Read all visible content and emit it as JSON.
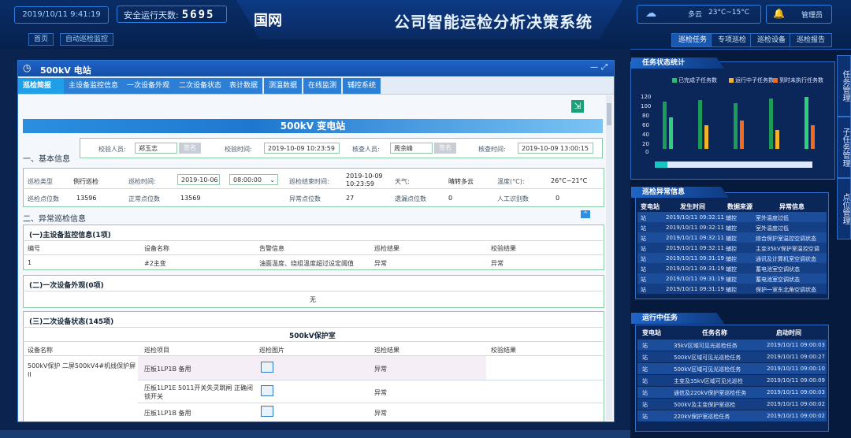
{
  "header": {
    "datetime": "2019/10/11 9:41:19",
    "safe_days_label": "安全运行天数:",
    "safe_days_value": "5695",
    "logo": "国网",
    "system_name": "公司智能运检分析决策系统",
    "weather_text": "多云",
    "temperature": "23°C~15°C",
    "user_label": "管理员",
    "breadcrumb": [
      "首页",
      "自动巡检监控"
    ],
    "nav_tabs": [
      "巡检任务",
      "专项巡检",
      "巡检设备",
      "巡检报告"
    ],
    "nav_active_index": 0
  },
  "window": {
    "title": "500kV 电站",
    "tabs": [
      "巡检简报",
      "主设备监控信息",
      "一次设备外观",
      "二次设备状态",
      "表计数据",
      "测温数据",
      "在线监测",
      "辅控系统"
    ],
    "active_tab": 0,
    "station_banner": "500kV 变电站",
    "sections": {
      "basic": "一、基本信息",
      "abnormal": "二、异常巡检信息"
    },
    "basic_info": {
      "reviewer_label": "校验人员:",
      "reviewer_value": "郑玉志",
      "sign_button": "签名",
      "review_time_label": "校验时间:",
      "review_time_value": "2019-10-09 10:23:59",
      "audit_label": "核查人员:",
      "audit_value": "周余峰",
      "audit_sign_button": "签名",
      "audit_time_label": "核查时间:",
      "audit_time_value": "2019-10-09 13:00:15"
    },
    "inspect_row1": {
      "type_label": "巡检类型",
      "type_value": "例行巡检",
      "time_label": "巡检时间:",
      "date_value": "2019-10-06",
      "hour_value": "08:00:00",
      "end_label": "巡检结束时间:",
      "end_value_line1": "2019-10-09",
      "end_value_line2": "10:23:59",
      "weather_label": "天气:",
      "weather_value": "晴转多云",
      "temp_label": "温度(°C):",
      "temp_value": "26°C~21°C"
    },
    "inspect_row2": {
      "points_label": "巡检点位数",
      "points_value": "13596",
      "normal_label": "正常点位数",
      "normal_value": "13569",
      "abnormal_label": "异常点位数",
      "abnormal_value": "27",
      "missing_label": "遗漏点位数",
      "missing_value": "0",
      "manual_label": "人工识别数",
      "manual_value": "0"
    },
    "sub1": {
      "title": "(一)主设备监控信息(1项)",
      "headers": [
        "编号",
        "设备名称",
        "告警信息",
        "巡检结果",
        "校验结果"
      ],
      "rows": [
        [
          "1",
          "#2主变",
          "油面温度、绕组温度超过设定阈值",
          "异常",
          "异常"
        ]
      ]
    },
    "sub2": {
      "title": "(二)一次设备外观(0项)",
      "empty": "无"
    },
    "sub3": {
      "title": "(三)二次设备状态(145项)",
      "group": "500kV保护室",
      "headers": [
        "设备名称",
        "巡检项目",
        "巡检图片",
        "巡检结果",
        "校验结果"
      ],
      "device": "500kV保护 二屏500kV4#机线保护屏II",
      "rows": [
        {
          "item": "压板1LP1B 备用",
          "result": "异常"
        },
        {
          "item": "压板1LP1E 5011开关失灵跳闸 正确闭锁开关",
          "result": "异常"
        },
        {
          "item": "压板1LP1B 备用",
          "result": "异常"
        }
      ]
    }
  },
  "task_stats": {
    "title": "任务状态统计",
    "legend": [
      "已完成子任务数",
      "运行中子任务数",
      "到时未执行任务数"
    ],
    "colors": {
      "done": "#26c16a",
      "running": "#f3b329",
      "overdue": "#f36a1f"
    },
    "yticks": [
      "120",
      "100",
      "80",
      "60",
      "40",
      "20",
      "0"
    ],
    "progress_fraction": 0.08
  },
  "abnormal_info": {
    "title": "巡检异常信息",
    "headers": [
      "变电站",
      "发生时间",
      "数据来源",
      "异常信息"
    ],
    "rows": [
      [
        "站",
        "2019/10/11 09:32:11",
        "辅控",
        "室外温度过低"
      ],
      [
        "站",
        "2019/10/11 09:32:11",
        "辅控",
        "室外温度过低"
      ],
      [
        "站",
        "2019/10/11 09:32:11",
        "辅控",
        "综合保护室温控空调状态"
      ],
      [
        "站",
        "2019/10/11 09:32:11",
        "辅控",
        "主变35kV保护室温控空调"
      ],
      [
        "站",
        "2019/10/11 09:31:19",
        "辅控",
        "通讯及计算机室空调状态"
      ],
      [
        "站",
        "2019/10/11 09:31:19",
        "辅控",
        "蓄电池室空调状态"
      ],
      [
        "站",
        "2019/10/11 09:31:19",
        "辅控",
        "蓄电池室空调状态"
      ],
      [
        "站",
        "2019/10/11 09:31:19",
        "辅控",
        "保护一室东北角空调状态"
      ]
    ]
  },
  "running_tasks": {
    "title": "运行中任务",
    "headers": [
      "变电站",
      "任务名称",
      "启动时间"
    ],
    "rows": [
      [
        "站",
        "35kV区域可见光巡检任务",
        "2019/10/11 09:00:03"
      ],
      [
        "站",
        "500kV区域可见光巡检任务",
        "2019/10/11 09:00:27"
      ],
      [
        "站",
        "500kV区域可见光巡检任务",
        "2019/10/11 09:00:10"
      ],
      [
        "站",
        "主变及35kV区域可见光巡检",
        "2019/10/11 09:00:09"
      ],
      [
        "站",
        "通信及220kV保护室巡检任务",
        "2019/10/11 09:00:03"
      ],
      [
        "站",
        "500kV及主变保护室巡检",
        "2019/10/11 09:00:02"
      ],
      [
        "站",
        "220kV保护室巡检任务",
        "2019/10/11 09:00:02"
      ]
    ]
  },
  "side_tabs": [
    "任务管理",
    "子任务管理",
    "点位管理"
  ]
}
